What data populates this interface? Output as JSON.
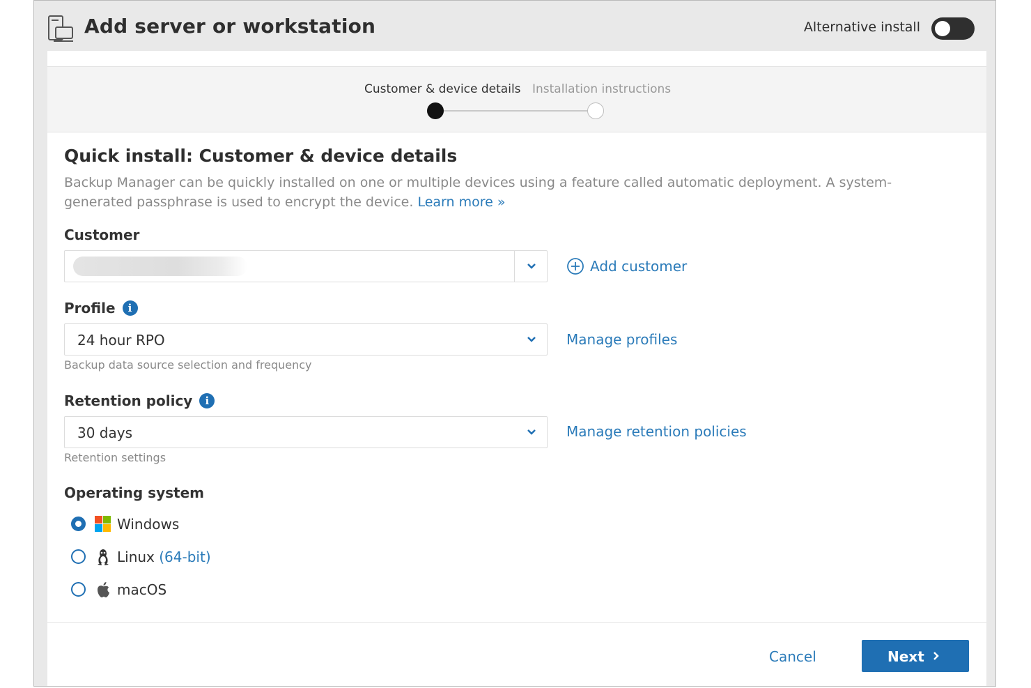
{
  "header": {
    "title": "Add server or workstation",
    "alternative_install_label": "Alternative install",
    "alternative_install_on": false
  },
  "stepper": {
    "steps": [
      {
        "label": "Customer & device details",
        "active": true
      },
      {
        "label": "Installation instructions",
        "active": false
      }
    ]
  },
  "main": {
    "title": "Quick install: Customer & device details",
    "description": "Backup Manager can be quickly installed on one or multiple devices using a feature called automatic deployment. A system-generated passphrase is used to encrypt the device.",
    "learn_more": "Learn more »",
    "customer": {
      "label": "Customer",
      "value": "",
      "add_link": "Add customer"
    },
    "profile": {
      "label": "Profile",
      "value": "24 hour RPO",
      "hint": "Backup data source selection and frequency",
      "manage_link": "Manage profiles"
    },
    "retention": {
      "label": "Retention policy",
      "value": "30 days",
      "hint": "Retention settings",
      "manage_link": "Manage retention policies"
    },
    "os": {
      "label": "Operating system",
      "options": [
        {
          "label": "Windows",
          "suffix": "",
          "icon": "windows-icon",
          "checked": true
        },
        {
          "label": "Linux",
          "suffix": "(64-bit)",
          "icon": "linux-icon",
          "checked": false
        },
        {
          "label": "macOS",
          "suffix": "",
          "icon": "apple-icon",
          "checked": false
        }
      ]
    }
  },
  "footer": {
    "cancel_label": "Cancel",
    "next_label": "Next"
  },
  "colors": {
    "accent": "#1f6fb3",
    "link": "#2b7bb9",
    "header_bg": "#e9e9e9"
  }
}
